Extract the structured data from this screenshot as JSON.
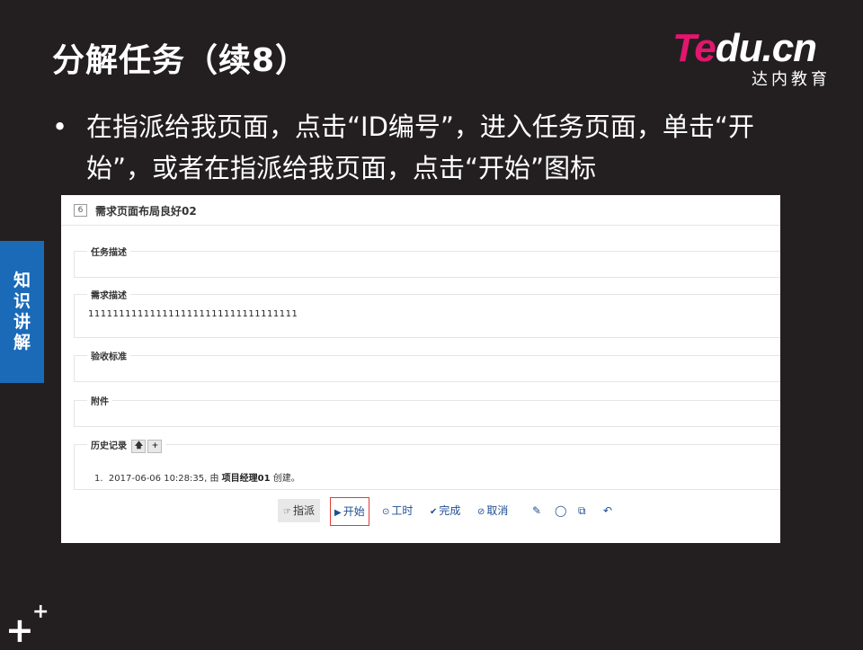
{
  "slide": {
    "title": "分解任务（续8）",
    "bullet_dot": "•",
    "bullet": "在指派给我页面，点击“ID编号”，进入任务页面，单击“开始”，或者在指派给我页面，点击“开始”图标",
    "side_tab": [
      "知",
      "识",
      "讲",
      "解"
    ],
    "logo_main_a": "Te",
    "logo_main_b": "du.cn",
    "logo_sub": "达内教育"
  },
  "screenshot": {
    "task_id": "6",
    "task_name": "需求页面布局良好02",
    "sections": [
      {
        "label": "任务描述",
        "body": ""
      },
      {
        "label": "需求描述",
        "body": "1111111111111111111111111111111111"
      },
      {
        "label": "验收标准",
        "body": ""
      },
      {
        "label": "附件",
        "body": ""
      }
    ],
    "history": {
      "label": "历史记录",
      "up_icon": "🡅",
      "plus_icon": "+",
      "item_index": "1.",
      "item_time": "2017-06-06 10:28:35, 由",
      "item_user": "项目经理01",
      "item_action": "创建。"
    },
    "actions": {
      "assign": "指派",
      "start": "开始",
      "hours": "工时",
      "finish": "完成",
      "cancel": "取消"
    }
  }
}
